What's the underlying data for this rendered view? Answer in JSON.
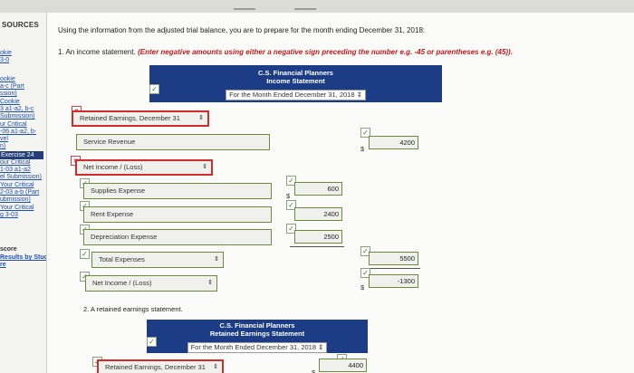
{
  "sidebar": {
    "heading": "SOURCES",
    "items": [
      {
        "label": "okie",
        "kind": "link"
      },
      {
        "label": "3-0",
        "kind": "link"
      },
      {
        "label": "ookie",
        "kind": "link"
      },
      {
        "label": "a-c (Part",
        "kind": "link"
      },
      {
        "label": "ssion)",
        "kind": "link"
      },
      {
        "label": "Cookie",
        "kind": "link"
      },
      {
        "label": "3 a1-a2, b-c",
        "kind": "link"
      },
      {
        "label": "Submission)",
        "kind": "link"
      },
      {
        "label": "ur Critical",
        "kind": "link"
      },
      {
        "label": "-06 a1-a2, b-",
        "kind": "link"
      },
      {
        "label": "vel",
        "kind": "link"
      },
      {
        "label": "n)",
        "kind": "link"
      },
      {
        "label": "Exercise 24",
        "kind": "active"
      },
      {
        "label": "our Critical",
        "kind": "link"
      },
      {
        "label": "1-03 a1-a2",
        "kind": "link"
      },
      {
        "label": "el Submission)",
        "kind": "link"
      },
      {
        "label": "Your Critical",
        "kind": "link"
      },
      {
        "label": "2-03 a-b (Part",
        "kind": "link"
      },
      {
        "label": "ubmission)",
        "kind": "link"
      },
      {
        "label": "Your Critical",
        "kind": "link"
      },
      {
        "label": "g 3-03",
        "kind": "link"
      }
    ],
    "score_label": "score",
    "results_label": "Results by Study",
    "results_label_2": "re"
  },
  "main": {
    "instruction": "Using the information from the adjusted trial balance, you are to prepare for the month ending December 31, 2018:",
    "q1_prefix": "1. An income statement.",
    "q1_note": "(Enter negative amounts using either a negative sign preceding the number e.g. -45 or parentheses e.g. (45)).",
    "income_banner": {
      "company": "C.S. Financial Planners",
      "statement": "Income Statement",
      "period": "For the Month Ended December 31, 2018"
    },
    "retained_select": "Retained Earnings, December 31",
    "service_revenue": {
      "label": "Service Revenue",
      "dollar": "$",
      "value": "4200"
    },
    "net_income_select": "Net Income / (Loss)",
    "expenses": [
      {
        "label": "Supplies Expense",
        "dollar": "$",
        "value": "600"
      },
      {
        "label": "Rent Expense",
        "dollar": "",
        "value": "2400"
      },
      {
        "label": "Depreciation Expense",
        "dollar": "",
        "value": "2500"
      }
    ],
    "total_expenses": {
      "label": "Total Expenses",
      "value": "5500"
    },
    "net_income": {
      "label": "Net Income / (Loss)",
      "dollar": "$",
      "value": "-1300"
    },
    "q2_label": "2. A retained earnings statement.",
    "re_banner": {
      "company": "C.S. Financial Planners",
      "statement": "Retained Earnings Statement",
      "period": "For the Month Ended December 31, 2018"
    },
    "re_row": {
      "label": "Retained Earnings, December 31",
      "dollar": "$",
      "value": "4400"
    },
    "check_mark": "✓",
    "x_mark": "×",
    "arrow_glyph": "⇕"
  }
}
